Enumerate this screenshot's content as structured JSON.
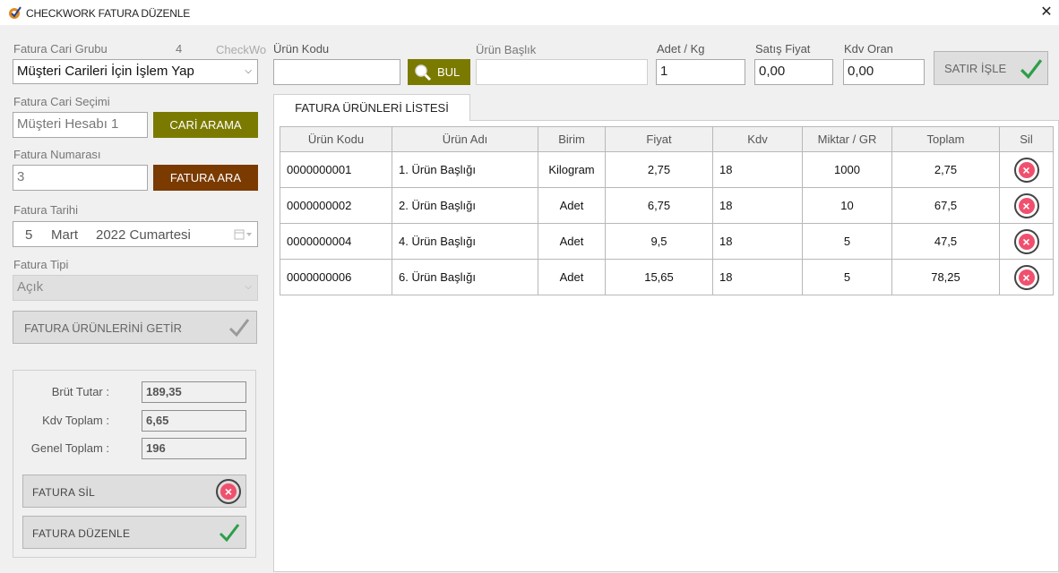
{
  "window": {
    "title": "CHECKWORK FATURA DÜZENLE",
    "close_glyph": "✕"
  },
  "left": {
    "cari_grubu_label": "Fatura Cari Grubu",
    "cari_grubu_count": "4",
    "cari_grubu_overflow": "CheckWo",
    "cari_grubu_value": "Müşteri Carileri İçin İşlem Yap",
    "cari_secimi_label": "Fatura Cari Seçimi",
    "cari_secimi_value": "Müşteri Hesabı 1",
    "cari_arama_label": "CARİ ARAMA",
    "numarasi_label": "Fatura Numarası",
    "numarasi_value": "3",
    "fatura_ara_label": "FATURA ARA",
    "tarih_label": "Fatura Tarihi",
    "tarih_day": "5",
    "tarih_month": "Mart",
    "tarih_year_day": "2022 Cumartesi",
    "tipi_label": "Fatura Tipi",
    "tipi_value": "Açık",
    "getir_label": "FATURA ÜRÜNLERİNİ GETİR"
  },
  "totals": {
    "brut_label": "Brüt Tutar :",
    "brut_value": "189,35",
    "kdv_label": "Kdv Toplam :",
    "kdv_value": "6,65",
    "genel_label": "Genel Toplam :",
    "genel_value": "196",
    "sil_label": "FATURA SİL",
    "duzenle_label": "FATURA DÜZENLE"
  },
  "entry": {
    "urun_kodu_label": "Ürün Kodu",
    "urun_kodu_value": "",
    "bul_label": "BUL",
    "urun_baslik_label": "Ürün Başlık",
    "urun_baslik_value": "",
    "adet_label": "Adet / Kg",
    "adet_value": "1",
    "satis_label": "Satış Fiyat",
    "satis_value": "0,00",
    "kdv_label": "Kdv Oran",
    "kdv_value": "0,00",
    "satir_isle_label": "SATIR İŞLE"
  },
  "list": {
    "tab_label": "FATURA ÜRÜNLERİ LİSTESİ",
    "columns": [
      "Ürün Kodu",
      "Ürün Adı",
      "Birim",
      "Fiyat",
      "Kdv",
      "Miktar / GR",
      "Toplam",
      "Sil"
    ],
    "rows": [
      {
        "kod": "0000000001",
        "ad": "1. Ürün Başlığı",
        "birim": "Kilogram",
        "fiyat": "2,75",
        "kdv": "18",
        "miktar": "1000",
        "toplam": "2,75"
      },
      {
        "kod": "0000000002",
        "ad": "2. Ürün Başlığı",
        "birim": "Adet",
        "fiyat": "6,75",
        "kdv": "18",
        "miktar": "10",
        "toplam": "67,5"
      },
      {
        "kod": "0000000004",
        "ad": "4. Ürün Başlığı",
        "birim": "Adet",
        "fiyat": "9,5",
        "kdv": "18",
        "miktar": "5",
        "toplam": "47,5"
      },
      {
        "kod": "0000000006",
        "ad": "6. Ürün Başlığı",
        "birim": "Adet",
        "fiyat": "15,65",
        "kdv": "18",
        "miktar": "5",
        "toplam": "78,25"
      }
    ]
  },
  "colors": {
    "olive": "#7b7a00",
    "brown": "#7a3a00",
    "delete_red": "#f0506e",
    "check_green": "#2e9e4a"
  }
}
